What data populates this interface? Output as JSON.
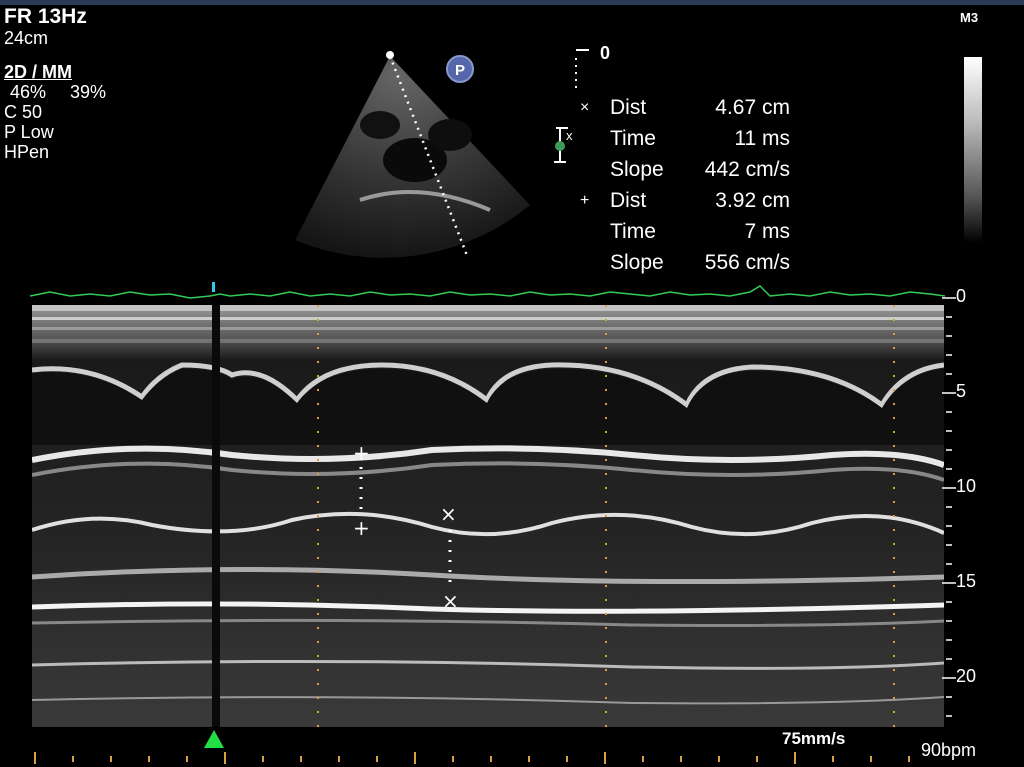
{
  "params": {
    "frame_rate": "FR 13Hz",
    "depth": "24cm",
    "mode": "2D / MM",
    "gain_2d": "46%",
    "gain_mm": "39%",
    "compression": "C 50",
    "power": "P Low",
    "frequency": "HPen"
  },
  "preset": "M3",
  "probe_badge": "P",
  "mini_depth_zero": "0",
  "measurements": [
    {
      "marker": "×",
      "label": "Dist",
      "value": "4.67 cm"
    },
    {
      "marker": "",
      "label": "Time",
      "value": "11 ms"
    },
    {
      "marker": "",
      "label": "Slope",
      "value": "442 cm/s"
    },
    {
      "marker": "+",
      "label": "Dist",
      "value": "3.92 cm"
    },
    {
      "marker": "",
      "label": "Time",
      "value": "7 ms"
    },
    {
      "marker": "",
      "label": "Slope",
      "value": "556 cm/s"
    }
  ],
  "depth_scale": [
    "0",
    "5",
    "10",
    "15",
    "20"
  ],
  "sweep_speed": "75mm/s",
  "heart_rate": "90bpm",
  "colors": {
    "ecg": "#33cc55",
    "cursor_marker": "#22dd44",
    "tick": "#d9a040",
    "timeline_cursor": "#33ccee"
  }
}
